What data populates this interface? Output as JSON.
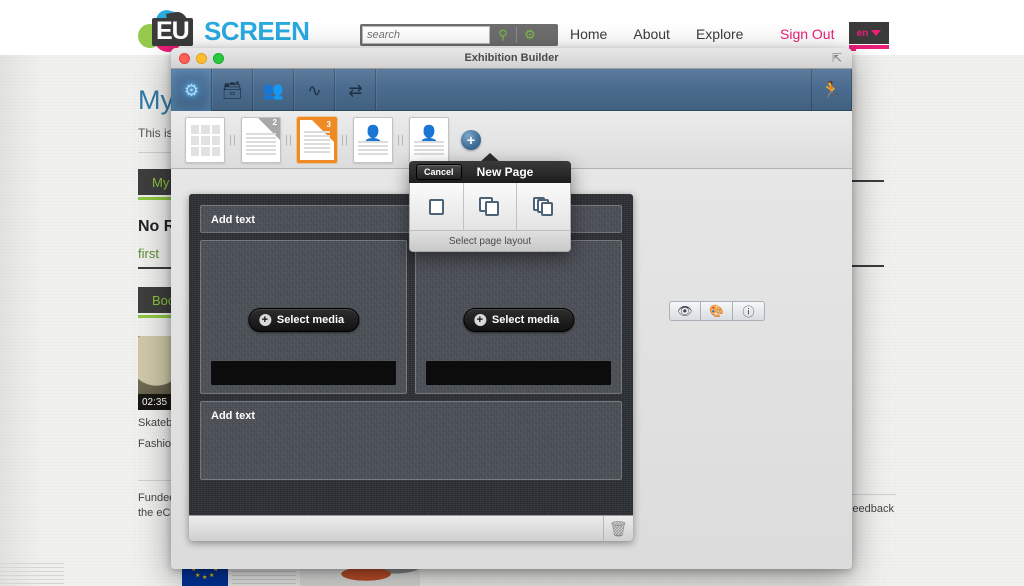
{
  "site": {
    "logo": {
      "eu": "EU",
      "screen": "SCREEN"
    },
    "search": {
      "placeholder": "search",
      "value": "",
      "search_icon": "search-icon",
      "settings_icon": "gear-icon"
    },
    "nav": [
      {
        "label": "Home"
      },
      {
        "label": "About"
      },
      {
        "label": "Explore"
      }
    ],
    "sign_out": "Sign Out",
    "language": {
      "code": "en",
      "caret": "chevron-down-icon"
    }
  },
  "background_page": {
    "heading": "My",
    "subtext": "This is",
    "tab_label": "My",
    "section_heading": "No R",
    "link": "first",
    "second_tab": "Boo",
    "thumb_duration": "02:35",
    "thumb_caption_1": "Skatebo",
    "thumb_caption_2": "Fashion",
    "footer_line_1": "Funded",
    "footer_line_2": "the eCo",
    "feedback": "Feedback"
  },
  "app_window": {
    "title": "Exhibition Builder",
    "traffic_lights": [
      "close-button",
      "minimize-button",
      "zoom-button"
    ],
    "resize_icon": "resize-icon",
    "toolbar": [
      {
        "name": "settings-tab",
        "icon": "gear-icon",
        "active": true
      },
      {
        "name": "archive-tab",
        "icon": "inbox-icon",
        "active": false
      },
      {
        "name": "people-tab",
        "icon": "people-icon",
        "active": false
      },
      {
        "name": "activity-tab",
        "icon": "pulse-icon",
        "active": false
      },
      {
        "name": "shuffle-tab",
        "icon": "shuffle-icon",
        "active": false
      }
    ],
    "toolbar_right": {
      "name": "preview-run-button",
      "icon": "running-person-icon"
    },
    "pages": [
      {
        "name": "page-thumb-grid",
        "type": "grid",
        "number": "",
        "selected": false
      },
      {
        "name": "page-thumb-2",
        "type": "corner",
        "number": "2",
        "selected": false
      },
      {
        "name": "page-thumb-3",
        "type": "corner",
        "number": "3",
        "selected": true
      },
      {
        "name": "page-thumb-person-1",
        "type": "person",
        "number": "",
        "selected": false
      },
      {
        "name": "page-thumb-person-2",
        "type": "person",
        "number": "",
        "selected": false
      }
    ],
    "add_page_button": "+",
    "canvas": {
      "text_zone_top": "Add text",
      "media_left_button": "Select media",
      "media_right_button": "Select media",
      "text_zone_bottom": "Add text"
    },
    "canvas_footer": {
      "trash_icon": "trash-icon"
    },
    "inspector": [
      {
        "name": "preview-eye-button",
        "icon": "eye-icon"
      },
      {
        "name": "theme-palette-button",
        "icon": "palette-icon"
      },
      {
        "name": "info-button",
        "icon": "info-icon"
      }
    ]
  },
  "new_page_popover": {
    "cancel_label": "Cancel",
    "title": "New Page",
    "footer_label": "Select page layout",
    "options": [
      {
        "name": "layout-single-page",
        "icon": "single-page-icon"
      },
      {
        "name": "layout-double-page",
        "icon": "double-page-icon"
      },
      {
        "name": "layout-multi-page",
        "icon": "multi-page-icon"
      }
    ]
  },
  "colors": {
    "brand_blue": "#29abe2",
    "brand_pink": "#ec1e79",
    "brand_green": "#8cc63f",
    "selection_orange": "#f08a24",
    "toolbar_blue": "#4a6b8e"
  }
}
